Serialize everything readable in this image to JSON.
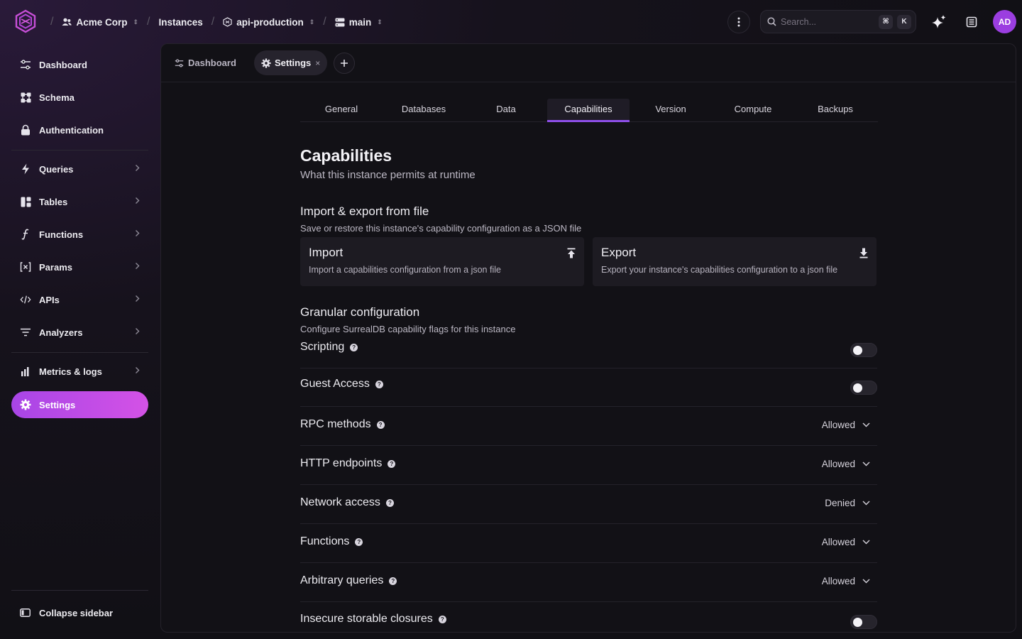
{
  "breadcrumbs": {
    "org": "Acme Corp",
    "instances": "Instances",
    "instance": "api-production",
    "branch": "main"
  },
  "header": {
    "search_placeholder": "Search...",
    "shortcut_mod": "⌘",
    "shortcut_key": "K",
    "avatar_initials": "AD"
  },
  "sidebar": {
    "items": [
      {
        "label": "Dashboard",
        "icon": "sliders-icon"
      },
      {
        "label": "Schema",
        "icon": "schema-icon"
      },
      {
        "label": "Authentication",
        "icon": "lock-icon"
      },
      {
        "label": "Queries",
        "icon": "bolt-icon"
      },
      {
        "label": "Tables",
        "icon": "tables-icon"
      },
      {
        "label": "Functions",
        "icon": "function-icon"
      },
      {
        "label": "Params",
        "icon": "params-icon"
      },
      {
        "label": "APIs",
        "icon": "code-icon"
      },
      {
        "label": "Analyzers",
        "icon": "filter-icon"
      },
      {
        "label": "Metrics & logs",
        "icon": "bar-chart-icon"
      },
      {
        "label": "Settings",
        "icon": "gear-icon"
      }
    ],
    "collapse_label": "Collapse sidebar"
  },
  "panel_tabs": [
    {
      "label": "Dashboard"
    },
    {
      "label": "Settings",
      "close": "×"
    }
  ],
  "settings_tabs": [
    "General",
    "Databases",
    "Data",
    "Capabilities",
    "Version",
    "Compute",
    "Backups"
  ],
  "capabilities": {
    "title": "Capabilities",
    "subtitle": "What this instance permits at runtime",
    "import_export": {
      "title": "Import & export from file",
      "subtitle": "Save or restore this instance's capability configuration as a JSON file",
      "import_title": "Import",
      "import_desc": "Import a capabilities configuration from a json file",
      "export_title": "Export",
      "export_desc": "Export your instance's capabilities configuration to a json file"
    },
    "granular": {
      "title": "Granular configuration",
      "subtitle": "Configure SurrealDB capability flags for this instance",
      "help_glyph": "?",
      "rows": [
        {
          "label": "Scripting",
          "type": "toggle",
          "enabled": false
        },
        {
          "label": "Guest Access",
          "type": "toggle",
          "enabled": false
        },
        {
          "label": "RPC methods",
          "type": "select",
          "value": "Allowed"
        },
        {
          "label": "HTTP endpoints",
          "type": "select",
          "value": "Allowed"
        },
        {
          "label": "Network access",
          "type": "select",
          "value": "Denied"
        },
        {
          "label": "Functions",
          "type": "select",
          "value": "Allowed"
        },
        {
          "label": "Arbitrary queries",
          "type": "select",
          "value": "Allowed"
        },
        {
          "label": "Insecure storable closures",
          "type": "toggle",
          "enabled": false
        }
      ]
    }
  },
  "colors": {
    "accent": "#a845e6",
    "tab_underline": "#8e4fe8",
    "avatar": "#9b3ee0"
  }
}
